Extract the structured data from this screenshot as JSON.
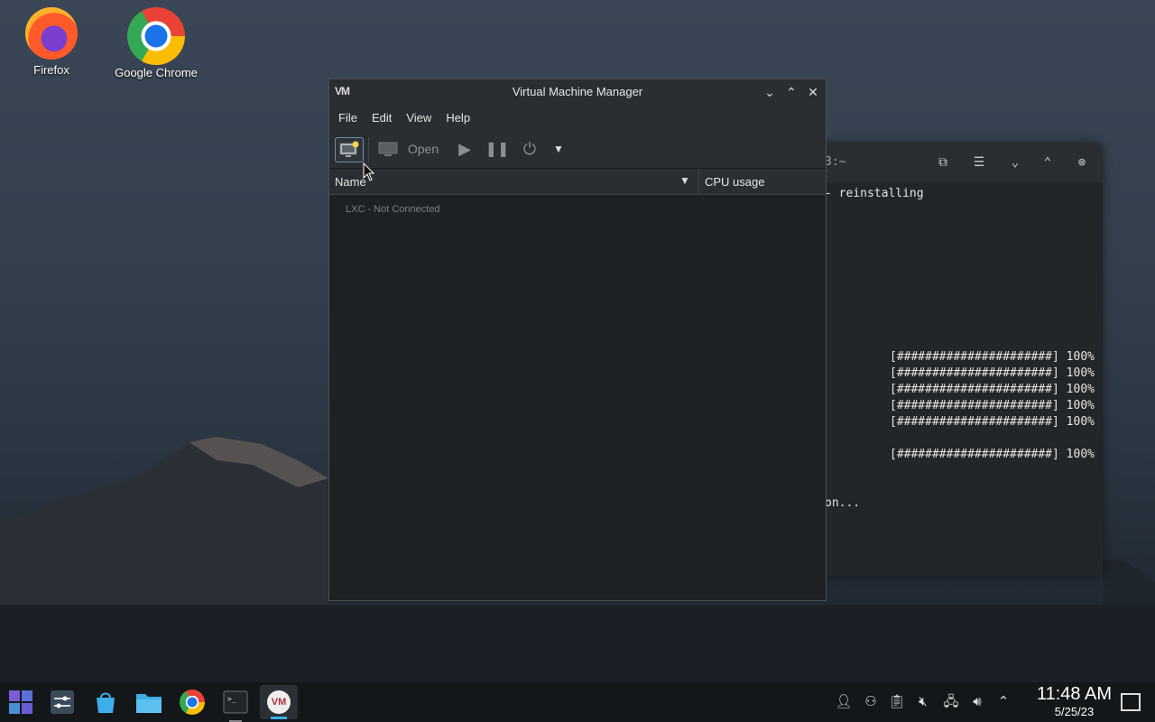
{
  "desktop": {
    "icons": [
      {
        "label": "Firefox"
      },
      {
        "label": "Google Chrome"
      }
    ]
  },
  "terminal": {
    "title_fragment": "3:~",
    "lines": [
      "- reinstalling",
      "[######################] 100%",
      "[######################] 100%",
      "[######################] 100%",
      "[######################] 100%",
      "[######################] 100%",
      "[######################] 100%",
      "on..."
    ]
  },
  "vmm": {
    "logo": "VM",
    "title": "Virtual Machine Manager",
    "menu": [
      "File",
      "Edit",
      "View",
      "Help"
    ],
    "toolbar": {
      "open_label": "Open"
    },
    "columns": {
      "name": "Name",
      "cpu": "CPU usage"
    },
    "connections": [
      {
        "label": "LXC - Not Connected"
      }
    ]
  },
  "taskbar": {
    "time": "11:48 AM",
    "date": "5/25/23"
  },
  "colors": {
    "accent": "#3daee9",
    "window_bg": "#1e2124",
    "taskbar_bg": "#141719"
  }
}
